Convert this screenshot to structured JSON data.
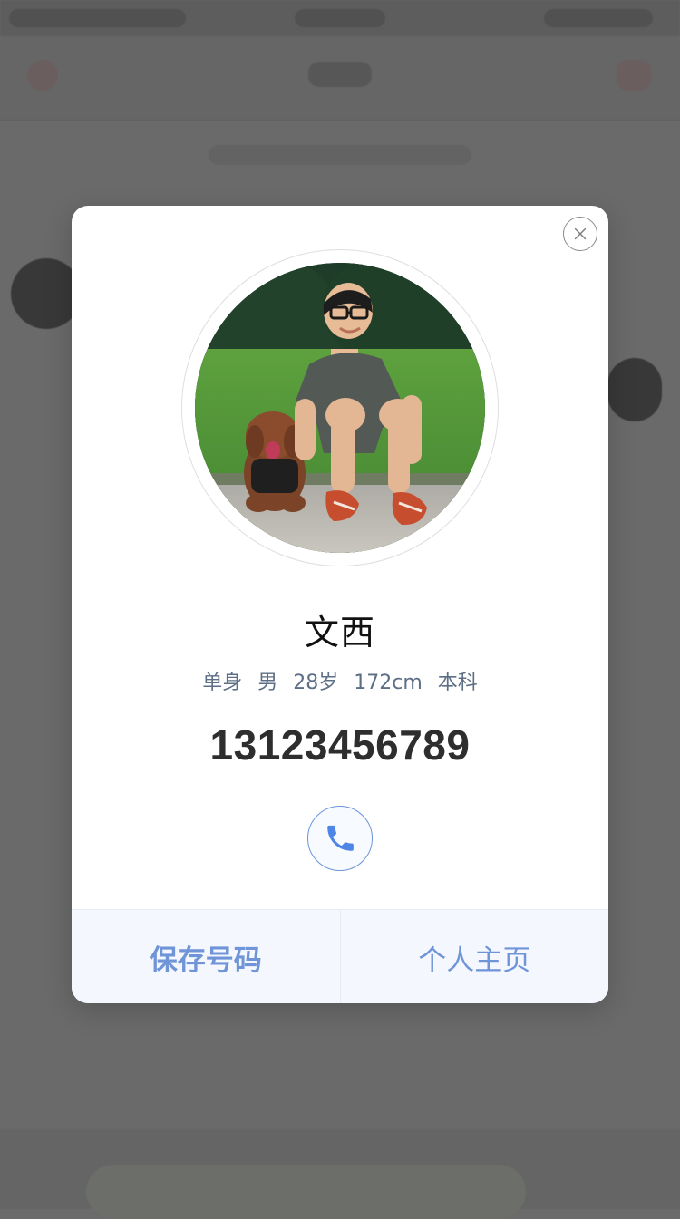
{
  "modal": {
    "name": "文西",
    "meta": [
      "单身",
      "男",
      "28岁",
      "172cm",
      "本科"
    ],
    "phone": "13123456789",
    "footer": {
      "save_label": "保存号码",
      "profile_label": "个人主页"
    },
    "icons": {
      "close": "close-icon",
      "phone": "phone-icon"
    },
    "colors": {
      "accent": "#6f95d8",
      "meta_text": "#5d6f86",
      "overlay": "#6b6b6b"
    }
  }
}
